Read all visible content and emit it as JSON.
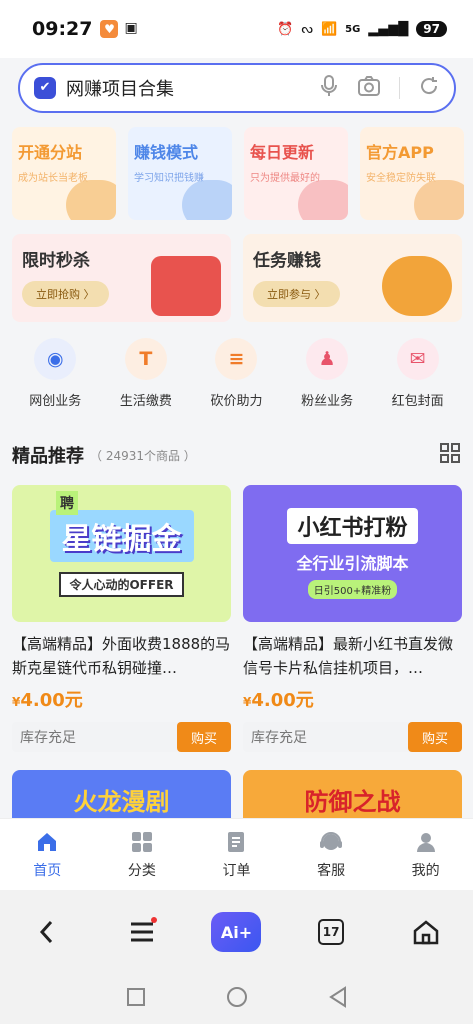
{
  "status": {
    "time": "09:27",
    "battery": "97",
    "network": "5G"
  },
  "search": {
    "text": "网赚项目合集"
  },
  "top_cards": [
    {
      "title": "开通分站",
      "sub": "成为站长当老板",
      "color": "#f39a33",
      "bg": "#fff3e3",
      "deco": "#f6c27a"
    },
    {
      "title": "赚钱模式",
      "sub": "学习知识把钱赚",
      "color": "#4e86e8",
      "bg": "#eaf2ff",
      "deco": "#a9c8f5"
    },
    {
      "title": "每日更新",
      "sub": "只为提供最好的",
      "color": "#e8534e",
      "bg": "#ffeeed",
      "deco": "#f6b0b3"
    },
    {
      "title": "官方APP",
      "sub": "安全稳定防失联",
      "color": "#f39a33",
      "bg": "#fff1e2",
      "deco": "#f5c084"
    }
  ],
  "promo_cards": [
    {
      "title": "限时秒杀",
      "button": "立即抢购 〉",
      "bg": "#fdecec",
      "btnbg": "#f3deb0",
      "deco": "#e8534e"
    },
    {
      "title": "任务赚钱",
      "button": "立即参与 〉",
      "bg": "#fdf1e6",
      "btnbg": "#f3deb0",
      "deco": "#f2a43a"
    }
  ],
  "quick": [
    {
      "label": "网创业务",
      "glyph": "◉",
      "bg": "#e9eefc",
      "fg": "#3b6ee8"
    },
    {
      "label": "生活缴费",
      "glyph": "T",
      "bg": "#fdeee2",
      "fg": "#f07c2a"
    },
    {
      "label": "砍价助力",
      "glyph": "≡",
      "bg": "#fdeee2",
      "fg": "#f07c2a"
    },
    {
      "label": "粉丝业务",
      "glyph": "♟",
      "bg": "#fde9ee",
      "fg": "#e8546a"
    },
    {
      "label": "红包封面",
      "glyph": "✉",
      "bg": "#fde9ee",
      "fg": "#e8546a"
    }
  ],
  "section": {
    "title": "精品推荐",
    "count": "（ 24931个商品 ）"
  },
  "products": [
    {
      "title": "【高端精品】外面收费1888的马斯克星链代币私钥碰撞…",
      "price_sym": "¥",
      "price": "4.00元",
      "stock": "库存充足",
      "buy": "购买",
      "img_text": "星链掘金",
      "img_sub": "令人心动的OFFER",
      "img_badge": "聘",
      "img_bg": "#dff5a8"
    },
    {
      "title": "【高端精品】最新小红书直发微信号卡片私信挂机项目，…",
      "price_sym": "¥",
      "price": "4.00元",
      "stock": "库存充足",
      "buy": "购买",
      "img_text": "小红书打粉",
      "img_sub": "全行业引流脚本",
      "img_badge": "日引500+精准粉",
      "img_bg": "#7f6cf0"
    }
  ],
  "products_more": [
    {
      "img_text": "火龙漫剧",
      "bg": "#5a7cf4",
      "fg": "#ffd23a"
    },
    {
      "img_text": "防御之战",
      "bg": "#f7a93a",
      "fg": "#d8232a"
    }
  ],
  "tabs": [
    {
      "label": "首页",
      "icon": "home-icon",
      "active": true
    },
    {
      "label": "分类",
      "icon": "category-icon",
      "active": false
    },
    {
      "label": "订单",
      "icon": "order-icon",
      "active": false
    },
    {
      "label": "客服",
      "icon": "service-icon",
      "active": false
    },
    {
      "label": "我的",
      "icon": "profile-icon",
      "active": false
    }
  ],
  "browser": {
    "ai_label": "Ai+",
    "cal": "17"
  },
  "colors": {
    "accent": "#3b6ee8",
    "price": "#f08a18"
  }
}
